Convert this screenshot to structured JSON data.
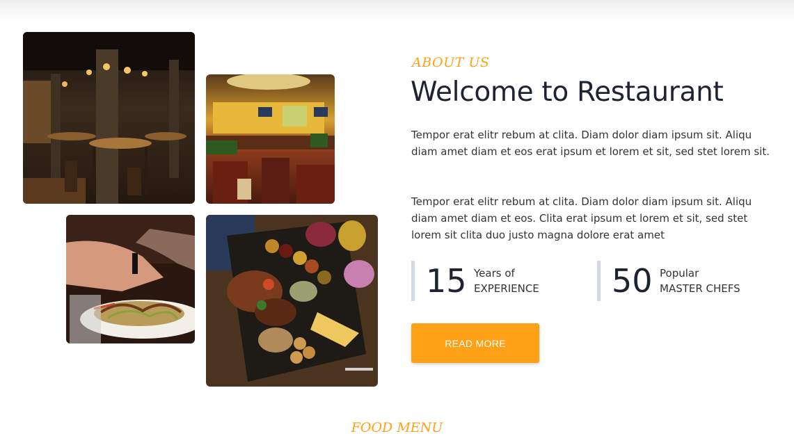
{
  "about": {
    "eyebrow": "ABOUT US",
    "title": "Welcome to Restaurant",
    "paragraph_1": "Tempor erat elitr rebum at clita. Diam dolor diam ipsum sit. Aliqu diam amet diam et eos erat ipsum et lorem et sit, sed stet lorem sit.",
    "paragraph_2": "Tempor erat elitr rebum at clita. Diam dolor diam ipsum sit. Aliqu diam amet diam et eos. Clita erat ipsum et lorem et sit, sed stet lorem sit clita duo justo magna dolore erat amet",
    "stats": [
      {
        "number": "15",
        "line1": "Years of",
        "line2": "EXPERIENCE"
      },
      {
        "number": "50",
        "line1": "Popular",
        "line2": "MASTER CHEFS"
      }
    ],
    "button_label": "READ MORE"
  },
  "next_section": {
    "eyebrow": "FOOD MENU"
  },
  "images": [
    {
      "icon": "restaurant-interior-photo"
    },
    {
      "icon": "dining-room-photo"
    },
    {
      "icon": "salad-plate-photo"
    },
    {
      "icon": "food-platter-photo"
    }
  ],
  "colors": {
    "accent": "#fea116",
    "heading": "#1f2230",
    "body_text": "#333333",
    "stat_border": "#d5dbe3"
  }
}
